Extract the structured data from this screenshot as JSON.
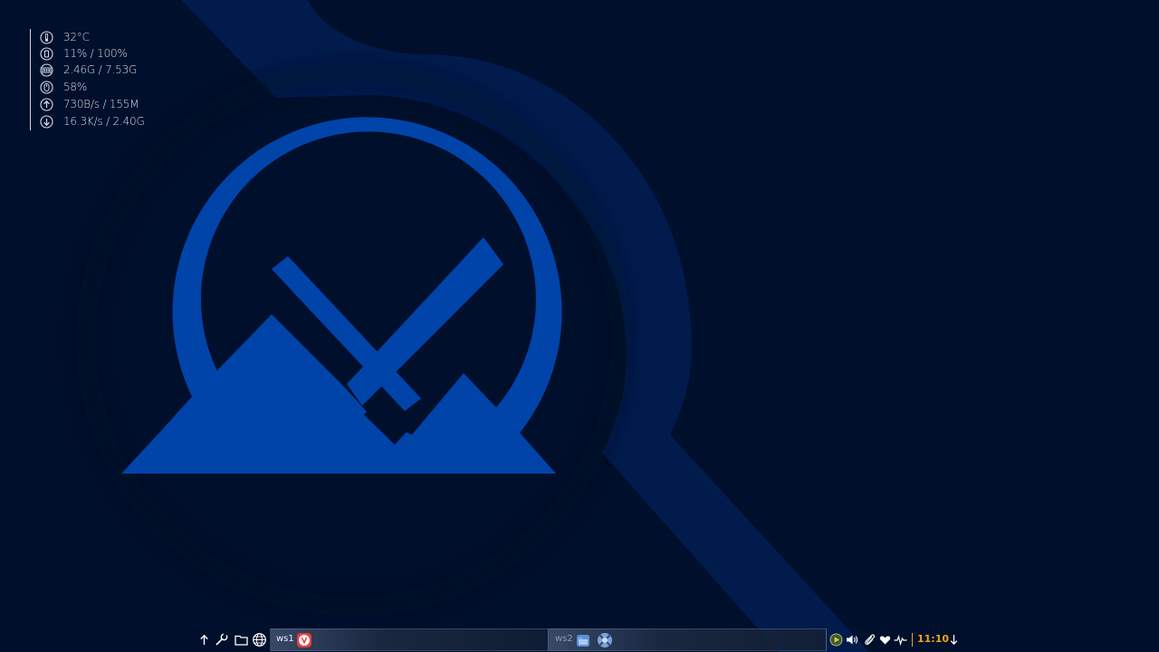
{
  "sysmon": {
    "temperature": "32°C",
    "cpu": "11% / 100%",
    "memory": "2.46G / 7.53G",
    "disk": "58%",
    "upload": "730B/s  /  155M",
    "download": "16.3K/s  /  2.40G"
  },
  "panel": {
    "workspaces": [
      {
        "label": "ws1"
      },
      {
        "label": "ws2"
      }
    ],
    "clock": "11:10"
  },
  "colors": {
    "background": "#000f2b",
    "logo_blue": "#0044aa",
    "accent_orange": "#f0a418",
    "vivaldi_red": "#ef3939"
  },
  "icons": {
    "sysmon": [
      "thermometer-icon",
      "cpu-icon",
      "memory-icon",
      "disk-icon",
      "upload-arrow-icon",
      "download-arrow-icon"
    ],
    "panel_tools": [
      "arrow-up-icon",
      "wrench-icon",
      "folder-icon",
      "globe-icon"
    ],
    "tray": [
      "media-play-icon",
      "volume-icon",
      "paperclip-icon",
      "heart-icon",
      "activity-icon",
      "download-icon"
    ]
  }
}
